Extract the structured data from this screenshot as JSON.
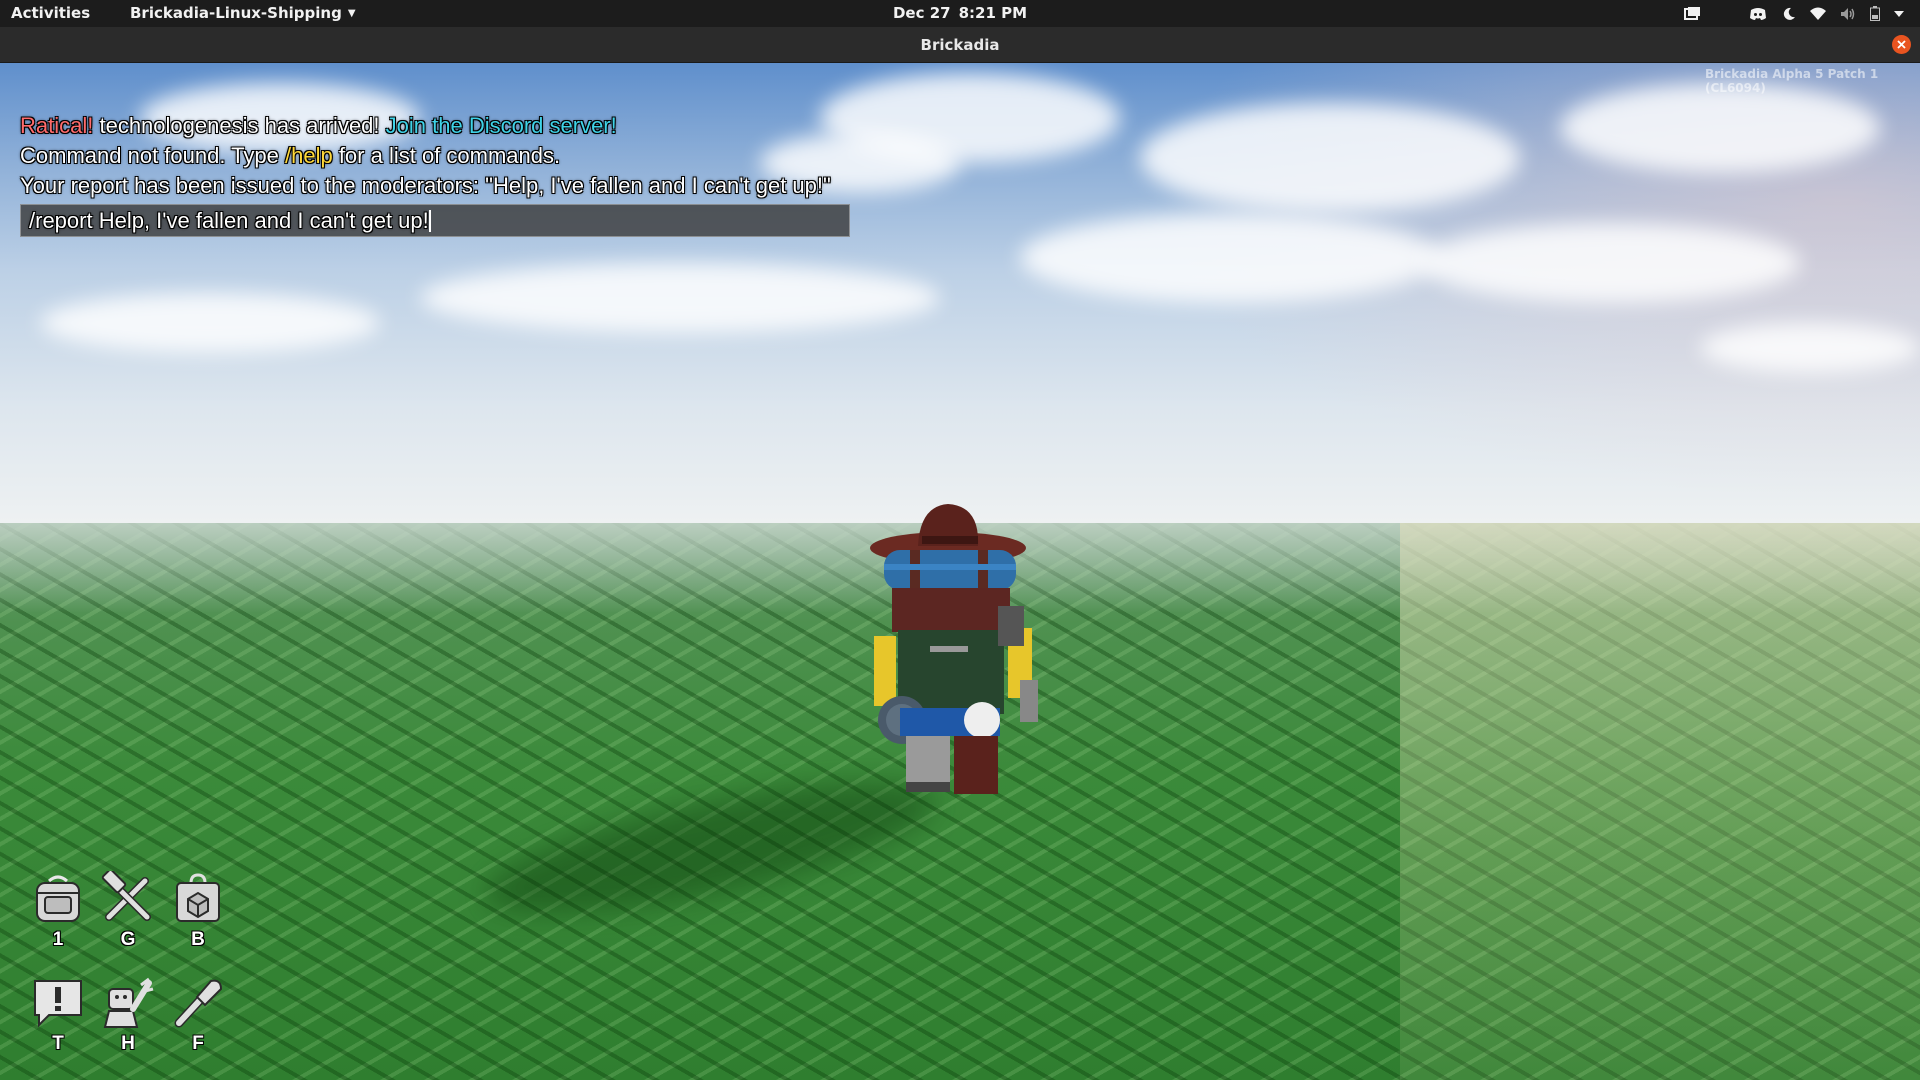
{
  "topbar": {
    "activities": "Activities",
    "app_name": "Brickadia-Linux-Shipping",
    "date": "Dec 27",
    "time": "8:21 PM"
  },
  "window": {
    "title": "Brickadia"
  },
  "game": {
    "version": "Brickadia Alpha 5 Patch 1 (CL6094)",
    "chat": {
      "line1": {
        "server_name": "Ratical!",
        "message": " technologenesis has arrived! ",
        "link": "Join the Discord server!"
      },
      "line2": {
        "prefix": "Command not found. Type ",
        "command": "/help",
        "suffix": " for a list of commands."
      },
      "line3": "Your report has been issued to the moderators: \"Help, I've fallen and I can't get up!\"",
      "input_value": "/report Help, I've fallen and I can't get up!"
    },
    "hotbar": [
      {
        "icon": "backpack-icon",
        "key": "1"
      },
      {
        "icon": "hammer-wrench-icon",
        "key": "G"
      },
      {
        "icon": "brick-bag-icon",
        "key": "B"
      },
      {
        "icon": "chat-alert-icon",
        "key": "T"
      },
      {
        "icon": "minifig-emote-icon",
        "key": "H"
      },
      {
        "icon": "flashlight-icon",
        "key": "F"
      }
    ]
  },
  "colors": {
    "server_name": "#ff6b6b",
    "discord_link": "#3fd3e8",
    "command": "#ffd93a",
    "close_button": "#e95420"
  }
}
